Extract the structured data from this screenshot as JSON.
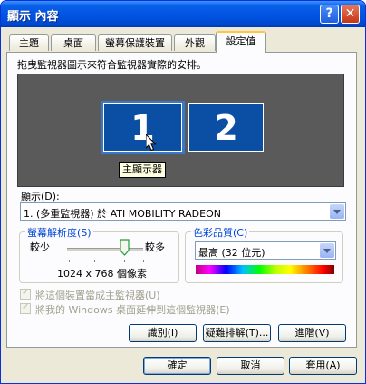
{
  "window": {
    "title": "顯示 內容"
  },
  "tabs": [
    {
      "label": "主題",
      "active": false
    },
    {
      "label": "桌面",
      "active": false
    },
    {
      "label": "螢幕保護裝置",
      "active": false
    },
    {
      "label": "外觀",
      "active": false
    },
    {
      "label": "設定值",
      "active": true
    }
  ],
  "instruction": "拖曳監視器圖示來符合監視器實際的安排。",
  "monitors": [
    {
      "number": "1",
      "selected": true
    },
    {
      "number": "2",
      "selected": false
    }
  ],
  "tooltip": "主顯示器",
  "display": {
    "label": "顯示(D):",
    "value": "1. (多重監視器) 於 ATI MOBILITY RADEON"
  },
  "resolution": {
    "legend": "螢幕解析度(S)",
    "less": "較少",
    "more": "較多",
    "value_text": "1024 x 768 個像素"
  },
  "color_quality": {
    "legend": "色彩品質(C)",
    "value": "最高 (32 位元)"
  },
  "checkboxes": [
    {
      "label": "將這個裝置當成主監視器(U)",
      "checked": true,
      "enabled": false
    },
    {
      "label": "將我的 Windows 桌面延伸到這個監視器(E)",
      "checked": true,
      "enabled": false
    }
  ],
  "panel_buttons": {
    "identify": "識別(I)",
    "troubleshoot": "疑難排解(T)...",
    "advanced": "進階(V)"
  },
  "dialog_buttons": {
    "ok": "確定",
    "cancel": "取消",
    "apply": "套用(A)"
  },
  "colors": {
    "titlebar": "#0054e3",
    "monitor_fill": "#0a4fa3",
    "monitor_area": "#5a5a5a",
    "legend_text": "#0046d5",
    "close_button": "#c53514"
  }
}
